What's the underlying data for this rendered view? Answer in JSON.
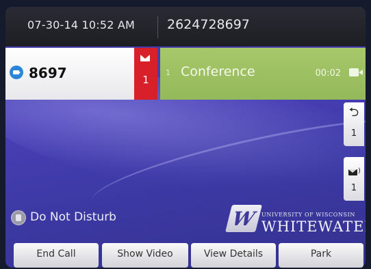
{
  "status_bar": {
    "datetime": "07-30-14 10:52 AM",
    "phone_number": "2624728697"
  },
  "line_key": {
    "label": "8697",
    "icon": "video-camera-icon",
    "voicemail_count": "1"
  },
  "active_call": {
    "index": "1",
    "label": "Conference",
    "timer": "00:02",
    "icon": "video-camera-icon",
    "color": "#9dc062"
  },
  "side_keys": [
    {
      "icon": "call-back-arrow-icon",
      "count": "1"
    },
    {
      "icon": "voicemail-envelope-icon",
      "count": "1"
    }
  ],
  "dnd": {
    "label": "Do Not Disturb",
    "icon": "dnd-phone-icon"
  },
  "logo": {
    "mark": "W",
    "top_text": "UNIVERSITY OF WISCONSIN",
    "main_text": "WHITEWATER"
  },
  "softkeys": [
    {
      "label": "End Call"
    },
    {
      "label": "Show Video"
    },
    {
      "label": "View Details"
    },
    {
      "label": "Park"
    }
  ],
  "colors": {
    "background_purple": "#4a3fb7",
    "voicemail_red": "#d8202a",
    "camera_blue": "#2a86d8"
  }
}
